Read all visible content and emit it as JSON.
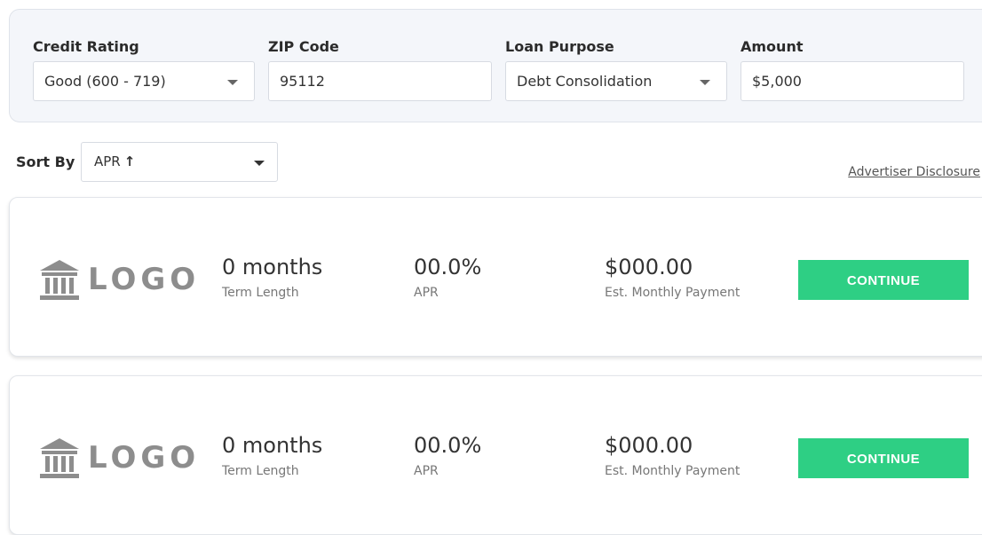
{
  "filters": {
    "credit_rating": {
      "label": "Credit Rating",
      "value": "Good (600 - 719)"
    },
    "zip_code": {
      "label": "ZIP Code",
      "value": "95112"
    },
    "loan_purpose": {
      "label": "Loan Purpose",
      "value": "Debt Consolidation"
    },
    "amount": {
      "label": "Amount",
      "value": "$5,000"
    }
  },
  "sort": {
    "label": "Sort By",
    "value": "APR",
    "arrow": "↑"
  },
  "disclosure": "Advertiser Disclosure",
  "offers": [
    {
      "logo_text": "LOGO",
      "term_value": "0 months",
      "term_label": "Term Length",
      "apr_value": "00.0%",
      "apr_label": "APR",
      "payment_value": "$000.00",
      "payment_label": "Est. Monthly Payment",
      "button_label": "CONTINUE"
    },
    {
      "logo_text": "LOGO",
      "term_value": "0 months",
      "term_label": "Term Length",
      "apr_value": "00.0%",
      "apr_label": "APR",
      "payment_value": "$000.00",
      "payment_label": "Est. Monthly Payment",
      "button_label": "CONTINUE"
    }
  ],
  "colors": {
    "accent": "#2ecf84",
    "panel_bg": "#f4f6fa",
    "logo_gray": "#8d8d8d"
  },
  "icons": {
    "logo": "bank-building-icon",
    "dropdown": "caret-down-icon"
  }
}
